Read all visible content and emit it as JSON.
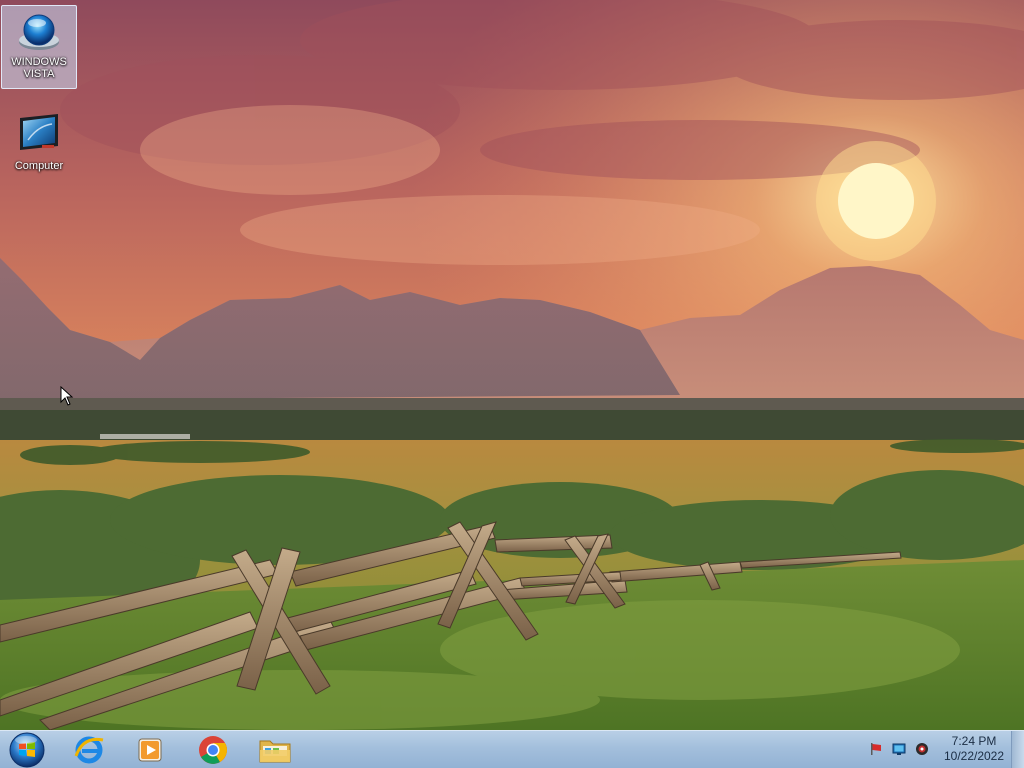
{
  "desktop": {
    "icons": [
      {
        "label": "WINDOWS VISTA",
        "icon": "windows-vista-orb-icon",
        "selected": true
      },
      {
        "label": "Computer",
        "icon": "computer-monitor-icon",
        "selected": false
      }
    ]
  },
  "taskbar": {
    "start": {
      "icon": "windows-start-orb-icon"
    },
    "pinned": [
      {
        "icon": "internet-explorer-icon"
      },
      {
        "icon": "media-player-icon"
      },
      {
        "icon": "chrome-icon"
      },
      {
        "icon": "file-explorer-folder-icon"
      }
    ],
    "tray": [
      {
        "icon": "flag-icon"
      },
      {
        "icon": "network-icon"
      },
      {
        "icon": "volume-icon"
      }
    ],
    "clock": {
      "time": "7:24 PM",
      "date": "10/22/2022"
    }
  },
  "colors": {
    "taskbar_top": "#b9cfe6",
    "taskbar_bottom": "#93b2d4",
    "sky_top": "#8f4a5c",
    "sun": "#fff6c8"
  }
}
